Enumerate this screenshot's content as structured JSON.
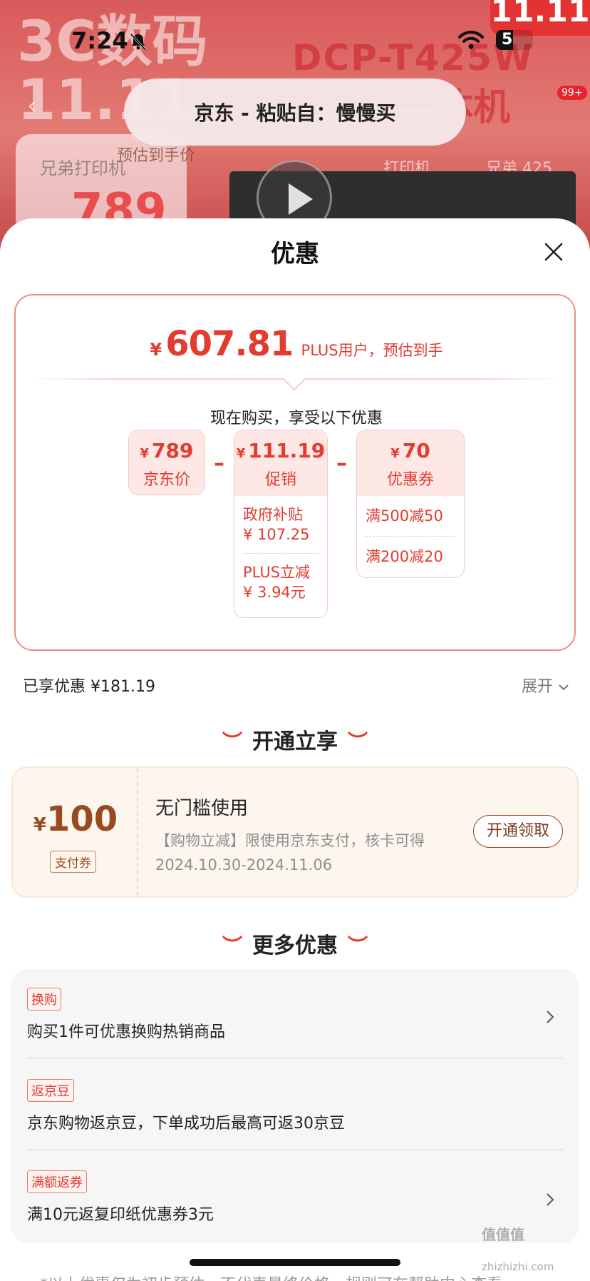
{
  "status_bar": {
    "time": "7:24",
    "battery": "5"
  },
  "background": {
    "headline_line1": "3C数码",
    "headline_line2": "11.11",
    "model": "DCP-T425W",
    "model_line2": "一体机",
    "promo_corner": "11.11",
    "cart_badge": "99+",
    "search_placeholder": "兄弟打印机",
    "est_label": "预估到手价",
    "price": "789",
    "link_printer": "打印机",
    "link_brother": "兄弟 425"
  },
  "paste_banner": {
    "text": "京东 - 粘贴自：慢慢买"
  },
  "sheet": {
    "title": "优惠",
    "estimate": {
      "symbol": "¥",
      "value": "607.81",
      "note": "PLUS用户，预估到手"
    },
    "subtitle": "现在购买，享受以下优惠",
    "jd_price": {
      "symbol": "¥",
      "value": "789",
      "label": "京东价"
    },
    "promotion": {
      "symbol": "¥",
      "value": "111.19",
      "label": "促销",
      "items": [
        {
          "name": "政府补贴",
          "amount": "¥ 107.25"
        },
        {
          "name": "PLUS立减",
          "amount": "¥ 3.94元"
        }
      ]
    },
    "coupon_box": {
      "symbol": "¥",
      "value": "70",
      "label": "优惠券",
      "items": [
        "满500减50",
        "满200减20"
      ]
    },
    "minus_sign": "–",
    "enjoyed": "已享优惠 ¥181.19",
    "expand": "展开",
    "open_section": {
      "title": "开通立享"
    },
    "pay_coupon": {
      "symbol": "¥",
      "amount": "100",
      "tag": "支付券",
      "title": "无门槛使用",
      "desc": "【购物立减】限使用京东支付，核卡可得",
      "date": "2024.10.30-2024.11.06",
      "button": "开通领取"
    },
    "more_section": {
      "title": "更多优惠"
    },
    "offers": [
      {
        "tag": "换购",
        "text": "购买1件可优惠换购热销商品"
      },
      {
        "tag": "返京豆",
        "text": "京东购物返京豆，下单成功后最高可返30京豆"
      },
      {
        "tag": "满额返券",
        "text": "满10元返复印纸优惠券3元"
      }
    ],
    "footer_note": "*以上优惠仅为初步预估，不代表最终价格，规则可在帮助中心查看"
  },
  "watermark": {
    "text": "值值值",
    "url": "zhizhizhi.com"
  },
  "colors": {
    "accent": "#e23b2f",
    "coupon_brown": "#9a4a20",
    "card_border": "#eb8f88"
  }
}
